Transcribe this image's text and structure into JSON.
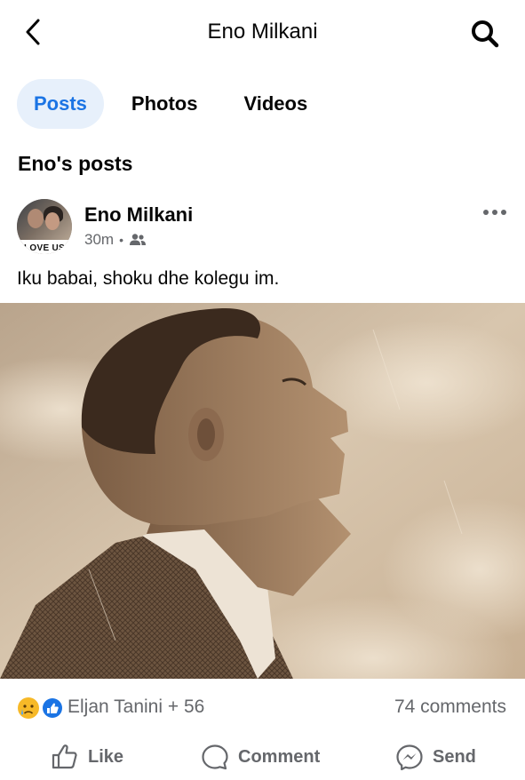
{
  "header": {
    "title": "Eno Milkani",
    "back_icon": "chevron-left-icon",
    "search_icon": "search-icon"
  },
  "tabs": [
    {
      "label": "Posts",
      "active": true
    },
    {
      "label": "Photos",
      "active": false
    },
    {
      "label": "Videos",
      "active": false
    }
  ],
  "section_title": "Eno's posts",
  "post": {
    "author": "Eno Milkani",
    "avatar_caption": "LOVE US",
    "time": "30m",
    "audience_icon": "friends-icon",
    "text": "Iku babai, shoku dhe kolegu im.",
    "reactions": {
      "icons": [
        "sad-reaction-icon",
        "like-reaction-icon"
      ],
      "summary": "Eljan Tanini + 56"
    },
    "comments": "74 comments"
  },
  "actions": {
    "like": "Like",
    "comment": "Comment",
    "send": "Send"
  },
  "colors": {
    "accent": "#1b74e4",
    "active_tab_bg": "#e7f0fb",
    "secondary_text": "#65676b"
  }
}
